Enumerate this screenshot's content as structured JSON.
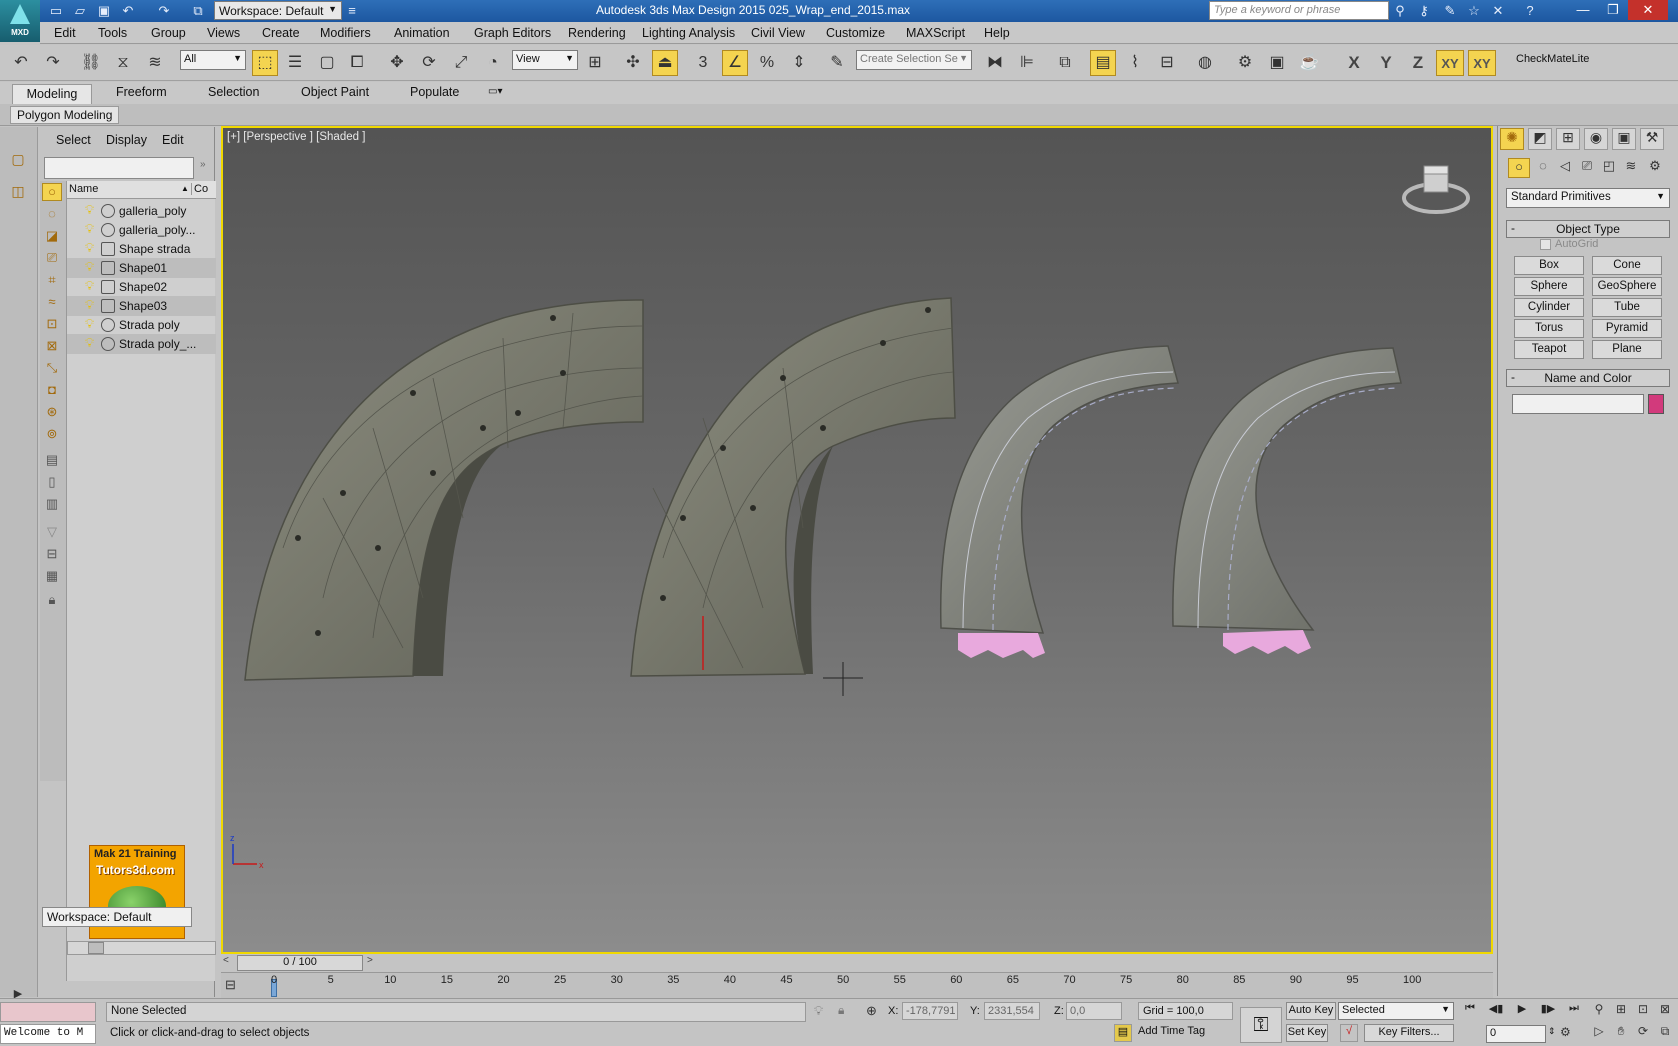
{
  "app": {
    "logo_text": "MXD",
    "title": "Autodesk 3ds Max Design 2015     025_Wrap_end_2015.max",
    "workspace": "Workspace: Default",
    "search_placeholder": "Type a keyword or phrase"
  },
  "menu": [
    "Edit",
    "Tools",
    "Group",
    "Views",
    "Create",
    "Modifiers",
    "Animation",
    "Graph Editors",
    "Rendering",
    "Lighting Analysis",
    "Civil View",
    "Customize",
    "MAXScript",
    "Help"
  ],
  "toolbar": {
    "selection_filter": "All",
    "reference_coord": "View",
    "named_selection_placeholder": "Create Selection Se",
    "axis_buttons": [
      "X",
      "Y",
      "Z",
      "XY",
      "XY"
    ],
    "plugin_label": "CheckMateLite"
  },
  "ribbon": {
    "tabs": [
      "Modeling",
      "Freeform",
      "Selection",
      "Object Paint",
      "Populate"
    ],
    "active_panel": "Polygon Modeling"
  },
  "explorer": {
    "menus": [
      "Select",
      "Display",
      "Edit"
    ],
    "columns": [
      "Name",
      "Co"
    ],
    "objects": [
      "galleria_poly",
      "galleria_poly...",
      "Shape strada",
      "Shape01",
      "Shape02",
      "Shape03",
      "Strada poly",
      "Strada poly_..."
    ],
    "workspace": "Workspace: Default",
    "logo_line1": "Mak 21 Training",
    "logo_line2": "Tutors3d.com"
  },
  "viewport": {
    "label": "[+] [Perspective ] [Shaded ]",
    "border_color": "#f0d800"
  },
  "command_panel": {
    "category": "Standard Primitives",
    "object_type_title": "Object Type",
    "autogrid_label": "AutoGrid",
    "primitives": [
      "Box",
      "Cone",
      "Sphere",
      "GeoSphere",
      "Cylinder",
      "Tube",
      "Torus",
      "Pyramid",
      "Teapot",
      "Plane"
    ],
    "name_color_title": "Name and Color",
    "object_color": "#d23a7c"
  },
  "timeline": {
    "frame_display": "0 / 100",
    "ticks": [
      "0",
      "5",
      "10",
      "15",
      "20",
      "25",
      "30",
      "35",
      "40",
      "45",
      "50",
      "55",
      "60",
      "65",
      "70",
      "75",
      "80",
      "85",
      "90",
      "95",
      "100"
    ]
  },
  "status": {
    "listener_text": "Welcome to M",
    "selection_status": "None Selected",
    "prompt": "Click or click-and-drag to select objects",
    "x_label": "X:",
    "x_value": "-178,7791",
    "y_label": "Y:",
    "y_value": "2331,554",
    "z_label": "Z:",
    "z_value": "0,0",
    "grid": "Grid = 100,0",
    "add_time_tag": "Add Time Tag",
    "auto_key": "Auto Key",
    "set_key": "Set Key",
    "key_mode": "Selected",
    "key_filters": "Key Filters...",
    "current_frame": "0"
  }
}
